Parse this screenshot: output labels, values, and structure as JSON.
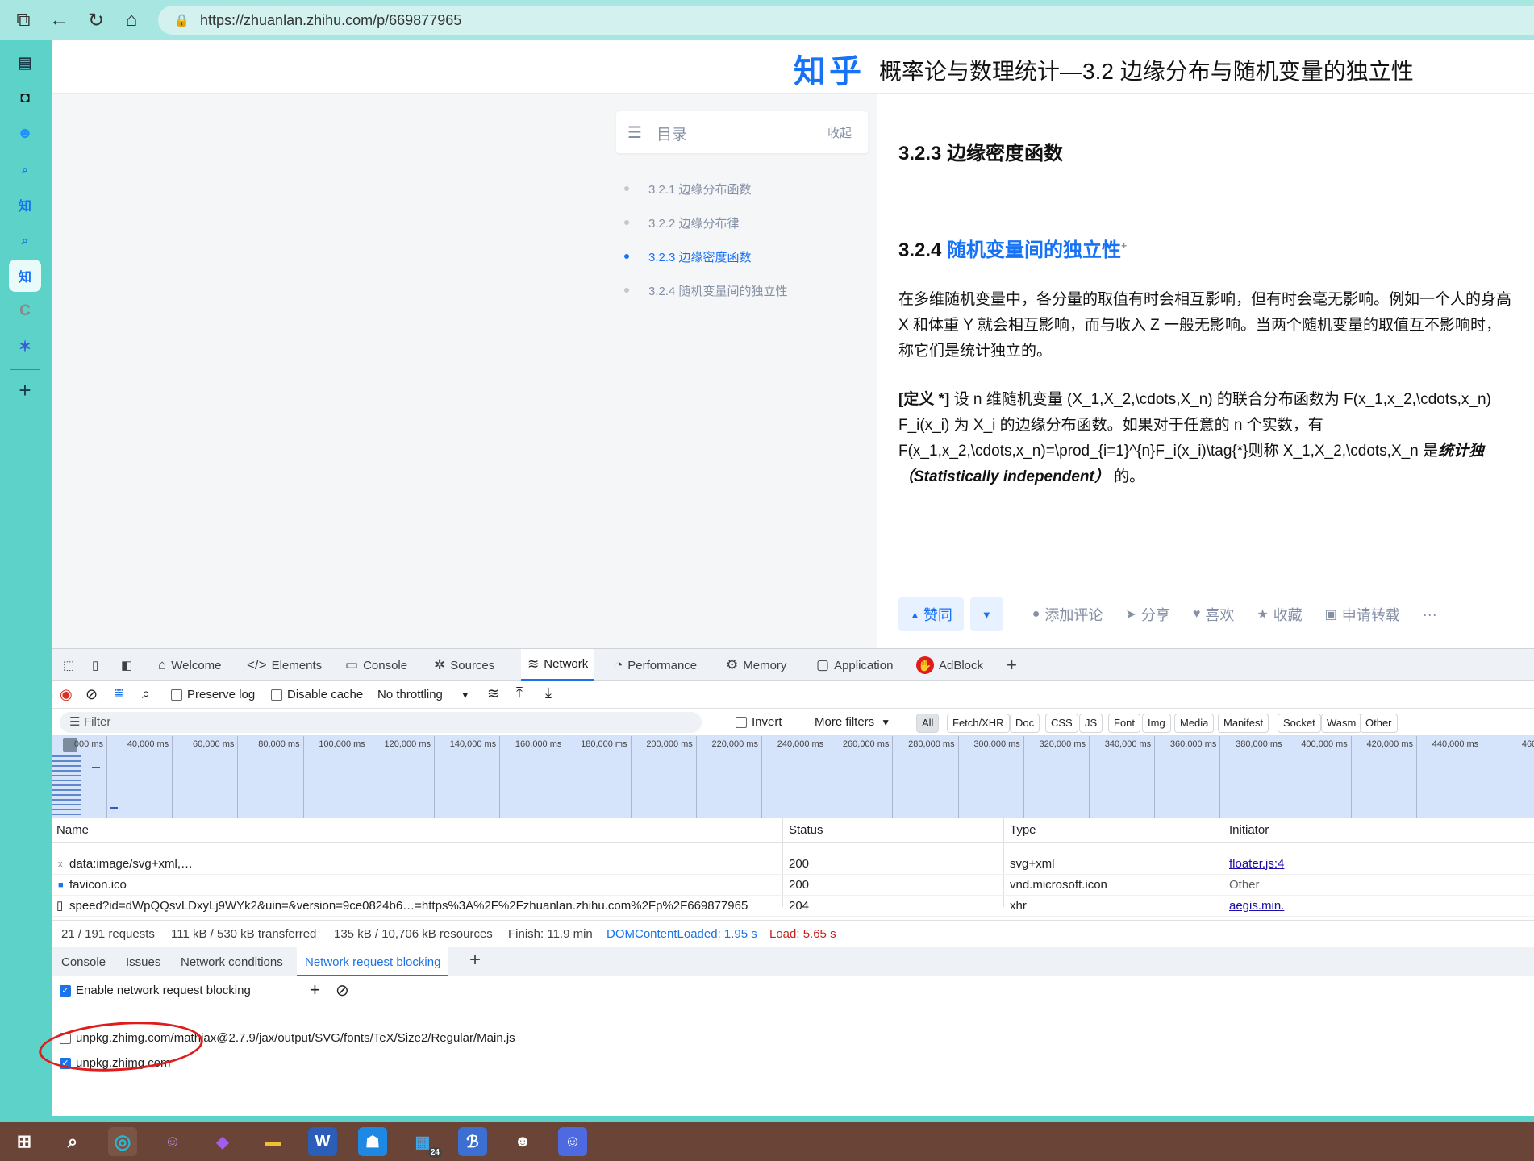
{
  "browser": {
    "url": "https://zhuanlan.zhihu.com/p/669877965"
  },
  "sidebar": {
    "items": [
      {
        "icon": "tab-panel-icon"
      },
      {
        "icon": "app-icon"
      },
      {
        "icon": "bilibili-icon"
      },
      {
        "icon": "search-icon"
      },
      {
        "icon": "zhihu-icon",
        "label": "知"
      },
      {
        "icon": "search-icon"
      },
      {
        "icon": "zhihu-icon-active",
        "label": "知"
      },
      {
        "icon": "c-icon",
        "label": "C"
      },
      {
        "icon": "star-app-icon"
      },
      {
        "icon": "add-icon"
      }
    ]
  },
  "page": {
    "logo": "知乎",
    "title": "概率论与数理统计—3.2 边缘分布与随机变量的独立性",
    "toc": {
      "label": "目录",
      "collapse": "收起",
      "items": [
        "3.2.1 边缘分布函数",
        "3.2.2 边缘分布律",
        "3.2.3 边缘密度函数",
        "3.2.4 随机变量间的独立性"
      ],
      "current": 2
    },
    "h_323": "3.2.3 边缘密度函数",
    "h_324_num": "3.2.4",
    "h_324_text": "随机变量间的独立性",
    "h_324_sup": "+",
    "para1": [
      "在多维随机变量中，各分量的取值有时会相互影响，但有时会毫无影响。例如一个人的身高",
      "X 和体重 Y 就会相互影响，而与收入 Z 一般无影响。当两个随机变量的取值互不影响时，",
      "称它们是统计独立的。"
    ],
    "def_label": "[定义 *]",
    "def_line1": " 设 n 维随机变量 (X_1,X_2,\\cdots,X_n) 的联合分布函数为 F(x_1,x_2,\\cdots,x_n)",
    "def_line2": "F_i(x_i) 为 X_i 的边缘分布函数。如果对于任意的 n 个实数，有",
    "def_line3": "F(x_1,x_2,\\cdots,x_n)=\\prod_{i=1}^{n}F_i(x_i)\\tag{*}则称 X_1,X_2,\\cdots,X_n 是",
    "def_line3_em": "统计独",
    "def_line4_em": "（Statistically independent）",
    "def_line4": "的。",
    "actions": {
      "upvote": "赞同",
      "comment": "添加评论",
      "share": "分享",
      "like": "喜欢",
      "favorite": "收藏",
      "repost": "申请转载",
      "more": "···"
    }
  },
  "devtools": {
    "tabs": [
      "Welcome",
      "Elements",
      "Console",
      "Sources",
      "Network",
      "Performance",
      "Memory",
      "Application",
      "AdBlock"
    ],
    "selected_tab": "Network",
    "toolbar": {
      "preserve_log": "Preserve log",
      "disable_cache": "Disable cache",
      "throttling": "No throttling"
    },
    "filter": {
      "placeholder": "Filter",
      "invert": "Invert",
      "more_filters": "More filters",
      "types": [
        "All",
        "Fetch/XHR",
        "Doc",
        "CSS",
        "JS",
        "Font",
        "Img",
        "Media",
        "Manifest",
        "Socket",
        "Wasm",
        "Other"
      ]
    },
    "timeline_ticks": [
      ",000 ms",
      "40,000 ms",
      "60,000 ms",
      "80,000 ms",
      "100,000 ms",
      "120,000 ms",
      "140,000 ms",
      "160,000 ms",
      "180,000 ms",
      "200,000 ms",
      "220,000 ms",
      "240,000 ms",
      "260,000 ms",
      "280,000 ms",
      "300,000 ms",
      "320,000 ms",
      "340,000 ms",
      "360,000 ms",
      "380,000 ms",
      "400,000 ms",
      "420,000 ms",
      "440,000 ms",
      "460,0"
    ],
    "columns": [
      "Name",
      "Status",
      "Type",
      "Initiator"
    ],
    "rows": [
      {
        "name": "data:image/svg+xml,…",
        "status": "200",
        "type": "svg+xml",
        "initiator": "floater.js:4"
      },
      {
        "name": "favicon.ico",
        "status": "200",
        "type": "vnd.microsoft.icon",
        "initiator": "Other"
      },
      {
        "name": "speed?id=dWpQQsvLDxyLj9WYk2&uin=&version=9ce0824b6…=https%3A%2F%2Fzhuanlan.zhihu.com%2Fp%2F669877965",
        "status": "204",
        "type": "xhr",
        "initiator": "aegis.min."
      }
    ],
    "summary": {
      "requests": "21 / 191 requests",
      "transferred": "111 kB / 530 kB transferred",
      "resources": "135 kB / 10,706 kB resources",
      "finish": "Finish: 11.9 min",
      "dcl": "DOMContentLoaded: 1.95 s",
      "load": "Load: 5.65 s"
    },
    "drawer_tabs": [
      "Console",
      "Issues",
      "Network conditions",
      "Network request blocking"
    ],
    "enable_blocking": "Enable network request blocking",
    "blocked_patterns": [
      {
        "pattern": "unpkg.zhimg.com/mathjax@2.7.9/jax/output/SVG/fonts/TeX/Size2/Regular/Main.js",
        "checked": false
      },
      {
        "pattern": "unpkg.zhimg.com",
        "checked": true
      }
    ]
  },
  "taskbar": {
    "badge": "24"
  }
}
